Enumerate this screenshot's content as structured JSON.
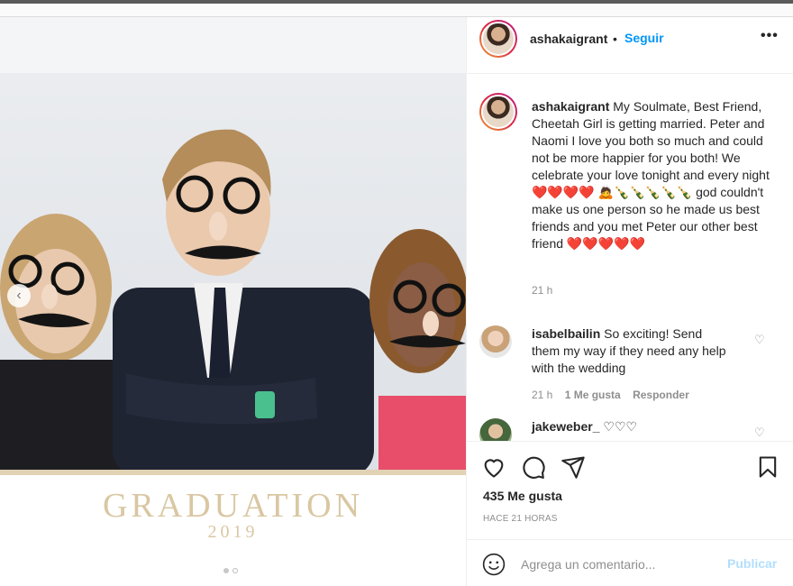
{
  "post": {
    "username": "ashakaigrant",
    "separator": "•",
    "follow_label": "Seguir",
    "more_label": "•••",
    "carousel_prev": "‹",
    "photo_caption_line1": "GRADUATION",
    "photo_caption_line2": "2019",
    "caption": {
      "username": "ashakaigrant",
      "text_1": "My Soulmate, Best Friend, Cheetah Girl is getting married. Peter and Naomi I love you both so much and could not be more happier for you both! We celebrate your love tonight and every night",
      "hearts_1": "❤️❤️❤️❤️",
      "emoji_row": "🙇🍾🍾🍾🍾🍾",
      "text_2": "god couldn't make us one person so he made us best friends and you met Peter our other best friend",
      "hearts_2": "❤️❤️❤️❤️❤️",
      "time": "21 h"
    },
    "comments": [
      {
        "username": "isabelbailin",
        "text": "So exciting! Send them my way if they need any help with the wedding",
        "time": "21 h",
        "likes": "1 Me gusta",
        "reply": "Responder"
      },
      {
        "username": "jakeweber_",
        "text": "♡♡♡"
      }
    ],
    "likes_count": "435 Me gusta",
    "time_ago": "HACE 21 HORAS",
    "comment_placeholder": "Agrega un comentario...",
    "publish_label": "Publicar",
    "carousel_index": 2,
    "carousel_total": 2
  },
  "colors": {
    "accent": "#0095f6",
    "heart": "#e0242f",
    "muted": "#8e8e8e",
    "publish_disabled": "#b2dffc"
  }
}
